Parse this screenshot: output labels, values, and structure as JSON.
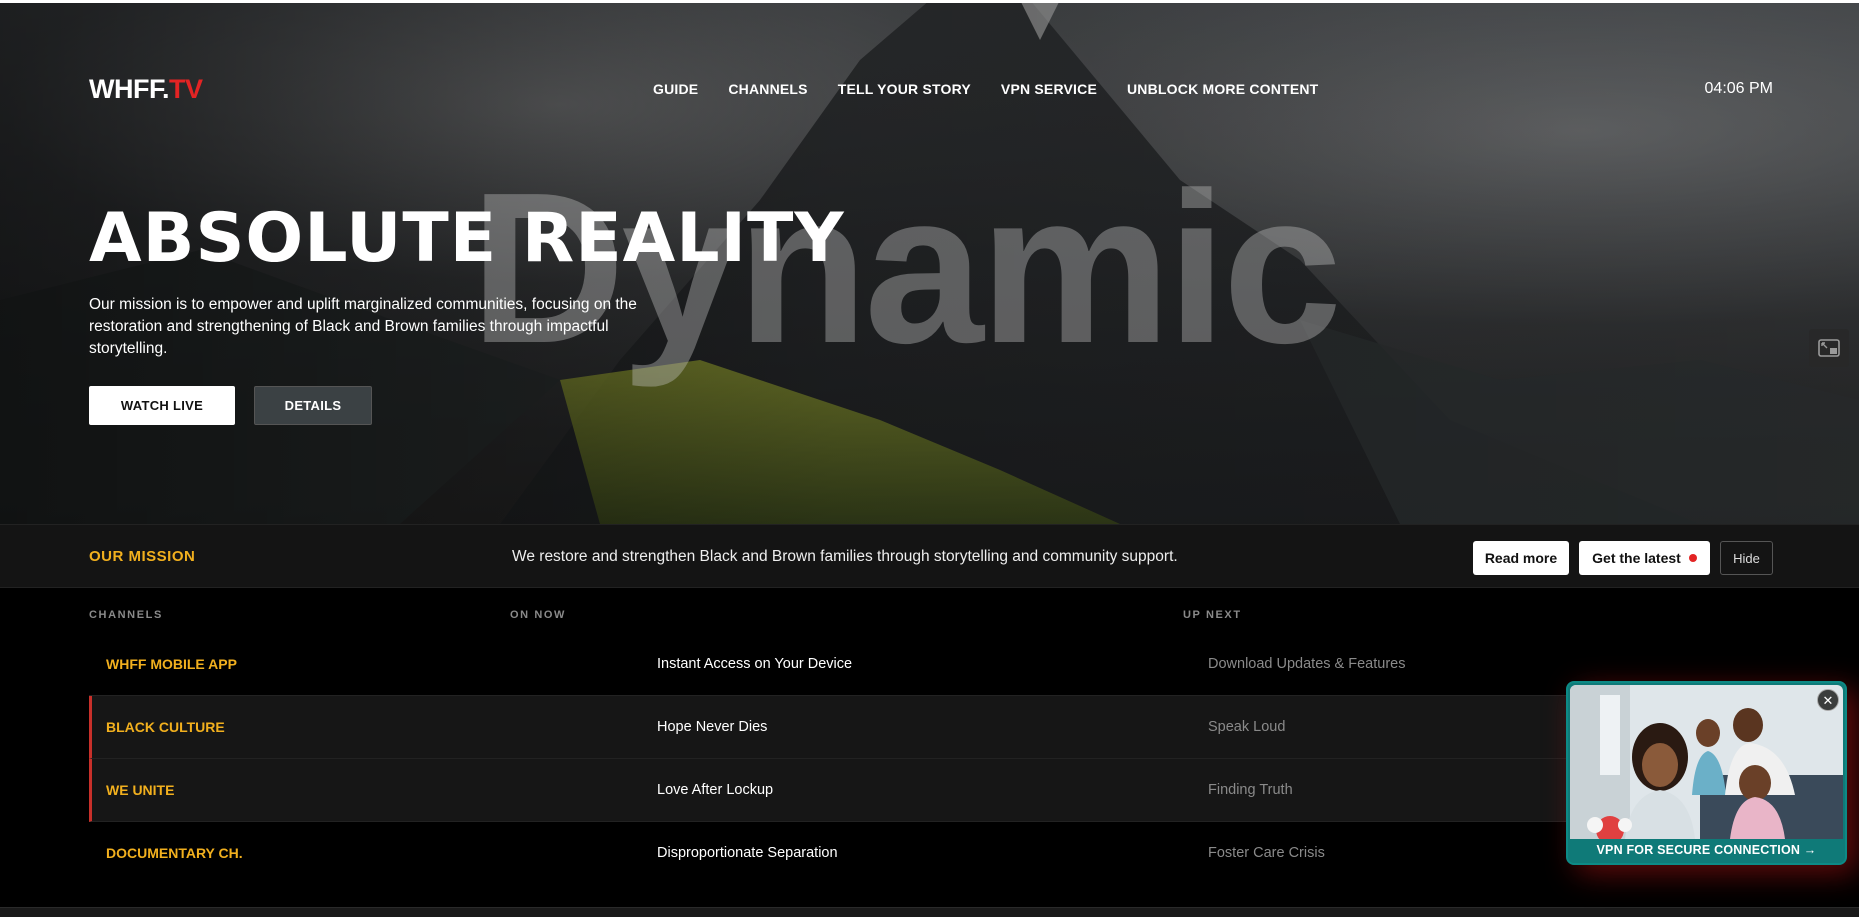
{
  "header": {
    "logo_main": "WHFF.",
    "logo_accent": "TV",
    "nav": [
      {
        "label": "GUIDE"
      },
      {
        "label": "CHANNELS"
      },
      {
        "label": "TELL YOUR STORY"
      },
      {
        "label": "VPN SERVICE"
      },
      {
        "label": "UNBLOCK MORE CONTENT"
      }
    ],
    "clock": "04:06 PM"
  },
  "hero": {
    "watermark": "Dynamic",
    "title": "ABSOLUTE REALITY",
    "description": "Our mission is to empower and uplift marginalized communities, focusing on the restoration and strengthening of Black and Brown families through impactful storytelling.",
    "watch_live": "WATCH LIVE",
    "details": "DETAILS"
  },
  "mission": {
    "label": "OUR MISSION",
    "text": "We restore and strengthen Black and Brown families through storytelling and community support.",
    "read_more": "Read more",
    "get_latest": "Get the latest",
    "hide": "Hide"
  },
  "guide": {
    "headers": {
      "channels": "CHANNELS",
      "on_now": "ON NOW",
      "up_next": "UP NEXT"
    },
    "rows": [
      {
        "channel": "WHFF MOBILE APP",
        "on_now": "Instant Access on Your Device",
        "up_next": "Download Updates & Features"
      },
      {
        "channel": "BLACK CULTURE",
        "on_now": "Hope Never Dies",
        "up_next": "Speak Loud"
      },
      {
        "channel": "WE UNITE",
        "on_now": "Love After Lockup",
        "up_next": "Finding Truth"
      },
      {
        "channel": "DOCUMENTARY CH.",
        "on_now": "Disproportionate Separation",
        "up_next": "Foster Care Crisis"
      }
    ]
  },
  "ad": {
    "cta": "VPN FOR SECURE CONNECTION →",
    "close_symbol": "✕"
  },
  "colors": {
    "accent_red": "#e32424",
    "accent_gold": "#f2b01e",
    "ad_teal": "#0f7a78"
  },
  "icons": [
    "picture-in-picture-icon",
    "close-icon",
    "live-dot-icon"
  ]
}
